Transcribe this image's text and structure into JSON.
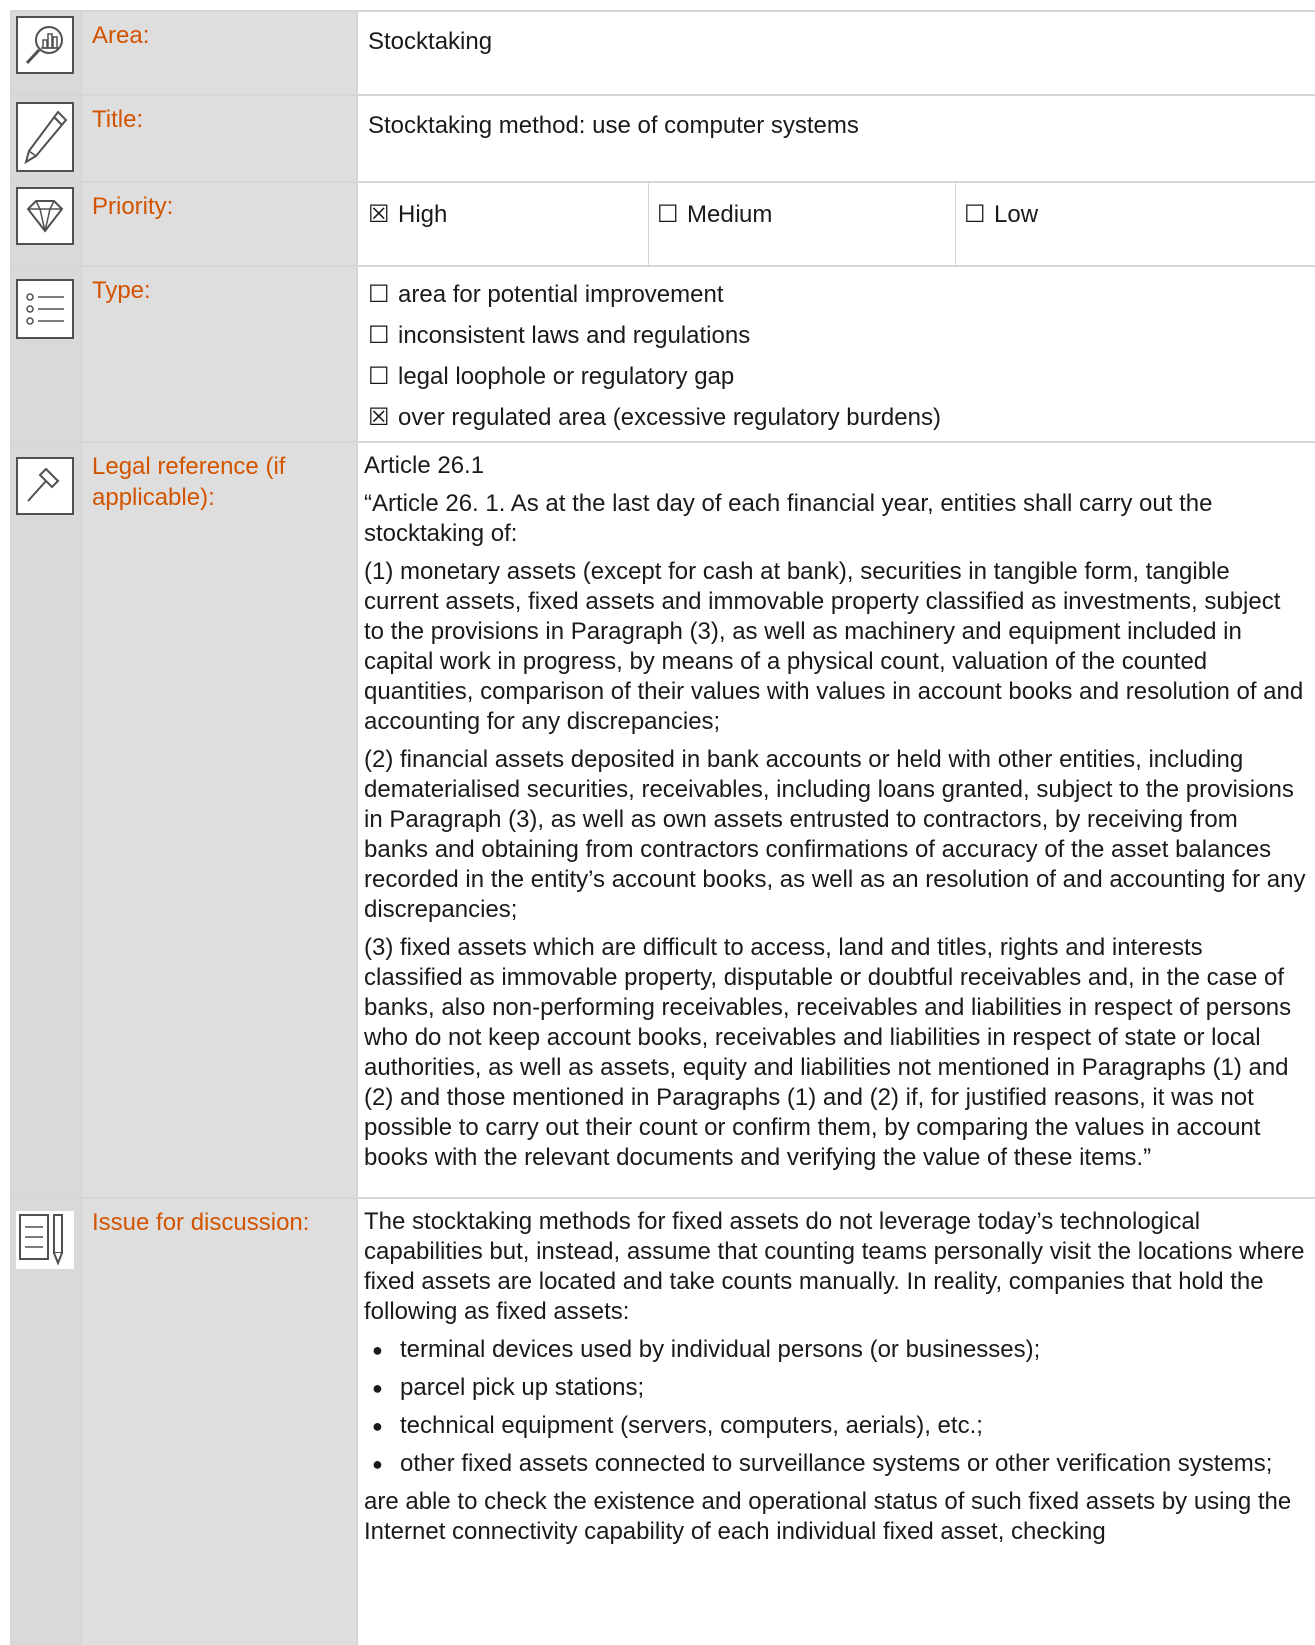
{
  "rows": {
    "area": {
      "label": "Area:",
      "value": "Stocktaking",
      "icon": "chart-magnifier-icon"
    },
    "title": {
      "label": "Title:",
      "value": "Stocktaking method: use of computer systems",
      "icon": "pencil-icon"
    },
    "priority": {
      "label": "Priority:",
      "icon": "diamond-icon",
      "options": [
        {
          "mark": "☒",
          "text": "High"
        },
        {
          "mark": "☐",
          "text": "Medium"
        },
        {
          "mark": "☐",
          "text": "Low"
        }
      ]
    },
    "type": {
      "label": "Type:",
      "icon": "list-icon",
      "options": [
        {
          "mark": "☐",
          "text": "area for potential improvement"
        },
        {
          "mark": "☐",
          "text": "inconsistent laws and regulations"
        },
        {
          "mark": "☐",
          "text": "legal loophole or regulatory gap"
        },
        {
          "mark": "☒",
          "text": "over regulated area (excessive regulatory burdens)"
        }
      ]
    },
    "legal": {
      "label": "Legal reference (if applicable):",
      "icon": "gavel-icon",
      "paragraphs": [
        "Article 26.1",
        "“Article 26. 1. As at the last day of each financial year, entities shall carry out the stocktaking of:",
        "(1) monetary assets (except for cash at bank), securities in tangible form, tangible current assets, fixed assets and immovable property classified as investments, subject to the provisions in Paragraph (3), as well as machinery and equipment included in capital work in progress, by means of a physical count, valuation of the counted quantities, comparison of their values with values in account books and resolution of and accounting for any discrepancies;",
        "(2) financial assets deposited in bank accounts or held with other entities, including dematerialised securities, receivables, including loans granted, subject to the provisions in Paragraph (3), as well as own assets entrusted to contractors, by receiving from banks and obtaining from contractors confirmations of accuracy of the asset balances recorded in the entity’s account books, as well as an resolution of and accounting for any discrepancies;",
        "(3) fixed assets which are difficult to access, land and titles, rights and interests classified as immovable property, disputable or doubtful receivables and, in the case of banks, also non-performing receivables, receivables and liabilities in respect of persons who do not keep account books, receivables and liabilities in respect of state or local authorities, as well as assets, equity and liabilities not mentioned in Paragraphs (1) and (2) and those mentioned in Paragraphs (1) and (2) if, for justified reasons, it was not possible to carry out their count or confirm them, by comparing the values in account books with the relevant documents and verifying the value of these items.”"
      ]
    },
    "issue": {
      "label": "Issue for discussion:",
      "icon": "document-pen-icon",
      "intro": "The stocktaking methods for fixed assets do not leverage today’s technological capabilities but, instead, assume that counting teams personally visit the locations where fixed assets are located and take counts manually. In reality, companies that hold the following as fixed assets:",
      "bullets": [
        "terminal devices used by individual persons (or businesses);",
        "parcel pick up stations;",
        "technical equipment (servers, computers, aerials), etc.;",
        "other fixed assets connected to surveillance systems or other verification systems;"
      ],
      "outro": "are able to check the existence and operational status of such fixed assets by using the Internet connectivity capability of each individual fixed asset, checking"
    }
  },
  "colors": {
    "label_orange": "#d35400",
    "grid_gray": "#d6d6d6",
    "cell_gray": "#d9d9d9"
  }
}
